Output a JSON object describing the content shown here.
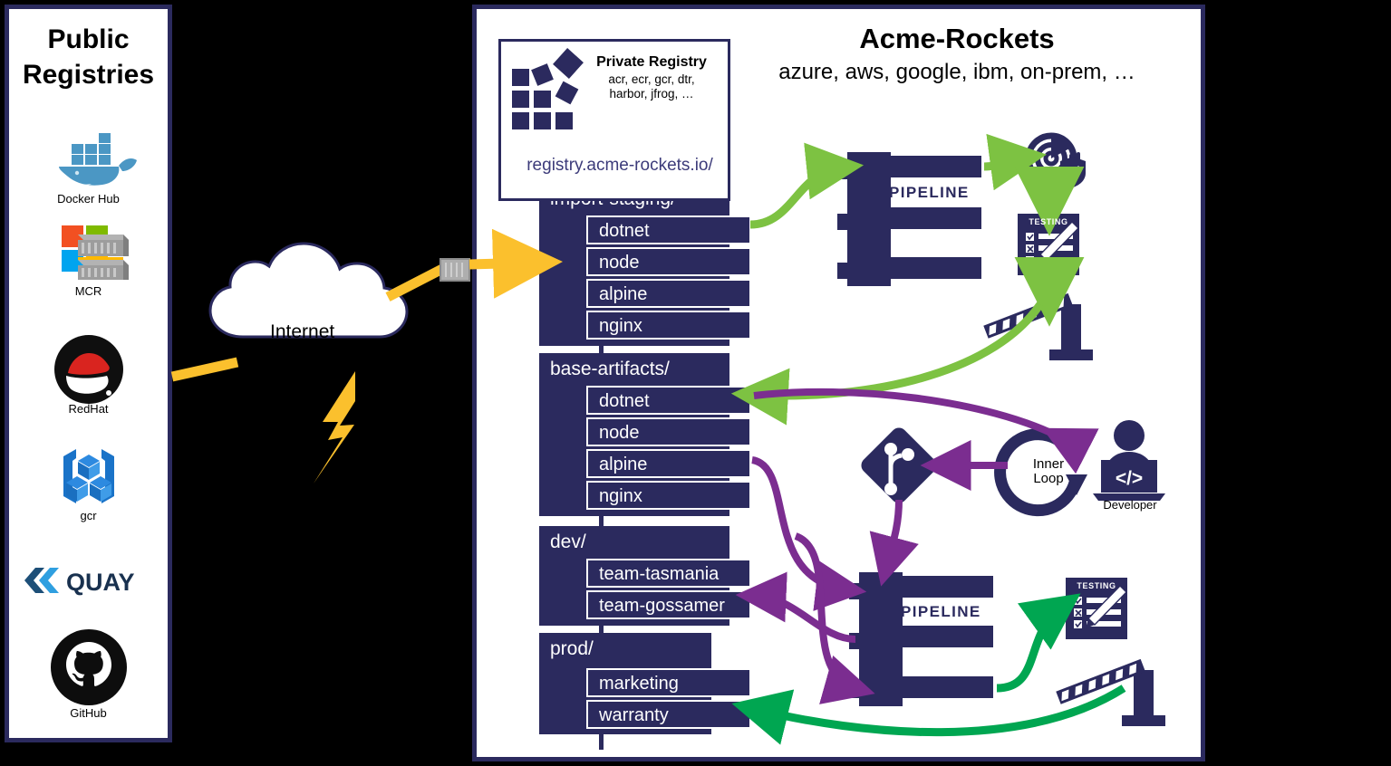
{
  "left_panel": {
    "title": "Public\nRegistries",
    "title_line1": "Public",
    "title_line2": "Registries",
    "registries": [
      {
        "name": "Docker Hub",
        "icon": "docker-whale-icon"
      },
      {
        "name": "MCR",
        "icon": "microsoft-container-registry-icon"
      },
      {
        "name": "RedHat",
        "icon": "redhat-fedora-icon"
      },
      {
        "name": "gcr",
        "icon": "google-container-registry-icon"
      },
      {
        "name": "",
        "icon": "quay-logo-icon",
        "logo_text": "QUAY"
      },
      {
        "name": "GitHub",
        "icon": "github-octocat-icon"
      }
    ]
  },
  "internet": {
    "label": "Internet",
    "icon": "cloud-icon",
    "lightning_icon": "lightning-bolt-icon",
    "container_icon": "container-icon"
  },
  "right_panel": {
    "title": "Acme-Rockets",
    "subtitle": "azure, aws, google, ibm, on-prem, …"
  },
  "private_registry": {
    "title": "Private Registry",
    "vendors_line1": "acr, ecr, gcr, dtr,",
    "vendors_line2": "harbor, jfrog, …",
    "url": "registry.acme-rockets.io/",
    "icon": "registry-squares-icon"
  },
  "repository_tree": [
    {
      "group": "import-staging/",
      "repos": [
        "dotnet",
        "node",
        "alpine",
        "nginx"
      ]
    },
    {
      "group": "base-artifacts/",
      "repos": [
        "dotnet",
        "node",
        "alpine",
        "nginx"
      ]
    },
    {
      "group": "dev/",
      "repos": [
        "team-tasmania",
        "team-gossamer"
      ]
    },
    {
      "group": "prod/",
      "repos": [
        "marketing",
        "warranty"
      ]
    }
  ],
  "pipelines": [
    {
      "label": "PIPELINE",
      "icon": "pipeline-icon"
    },
    {
      "label": "PIPELINE",
      "icon": "pipeline-icon"
    }
  ],
  "stages": {
    "scan_label": "",
    "scan_icon": "security-scan-shield-icon",
    "testing_label": "TESTING",
    "testing_icon": "testing-checklist-icon",
    "gate_icon": "quality-gate-barrier-icon",
    "git_icon": "git-repository-icon",
    "inner_loop_line1": "Inner",
    "inner_loop_line2": "Loop",
    "inner_loop_icon": "circular-arrow-icon",
    "developer_label": "Developer",
    "developer_icon": "developer-at-laptop-icon"
  },
  "colors": {
    "navy": "#2b2a5e",
    "green_light": "#7dc242",
    "green_dark": "#00a651",
    "purple": "#7b2d90",
    "yellow": "#fbc02d",
    "white": "#ffffff",
    "background": "#000000"
  }
}
